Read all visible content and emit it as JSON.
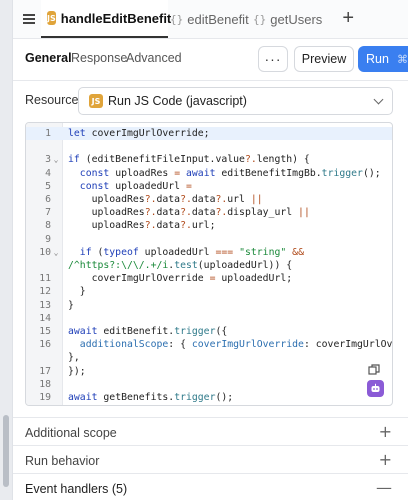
{
  "tabs": [
    {
      "label": "handleEditBenefit",
      "icon": "js-badge-icon",
      "badge": "JS"
    },
    {
      "label": "editBenefit",
      "icon": "query-icon"
    },
    {
      "label": "getUsers",
      "icon": "query-icon"
    }
  ],
  "subtabs": [
    "General",
    "Response",
    "Advanced"
  ],
  "toolbar": {
    "more_label": "···",
    "preview_label": "Preview",
    "run_label": "Run",
    "run_shortcut": "⌘↵"
  },
  "resource": {
    "label": "Resource",
    "badge": "JS",
    "value": "Run JS Code (javascript)"
  },
  "code_lines": [
    "let coverImgUrlOverride;",
    "",
    "if (editBenefitFileInput.value?.length) {",
    "  const uploadRes = await editBenefitImgBb.trigger();",
    "  const uploadedUrl =",
    "    uploadRes?.data?.data?.url ||",
    "    uploadRes?.data?.data?.display_url ||",
    "    uploadRes?.data?.url;",
    "",
    "  if (typeof uploadedUrl === \"string\" &&",
    "/^https?:\\/\\/.+/i.test(uploadedUrl)) {",
    "    coverImgUrlOverride = uploadedUrl;",
    "  }",
    "}",
    "",
    "await editBenefit.trigger({",
    "  additionalScope: { coverImgUrlOverride: coverImgUrlOverride",
    "},",
    "});",
    "",
    "await getBenefits.trigger();",
    ""
  ],
  "line_numbers": [
    "1",
    "",
    "3",
    "4",
    "5",
    "6",
    "7",
    "8",
    "9",
    "10",
    "",
    "11",
    "12",
    "13",
    "14",
    "15",
    "16",
    "",
    "17",
    "18",
    "19",
    "20"
  ],
  "sections": [
    {
      "label": "Additional scope",
      "icon": "+"
    },
    {
      "label": "Run behavior",
      "icon": "+"
    },
    {
      "label": "Event handlers (5)",
      "icon": "—"
    }
  ]
}
